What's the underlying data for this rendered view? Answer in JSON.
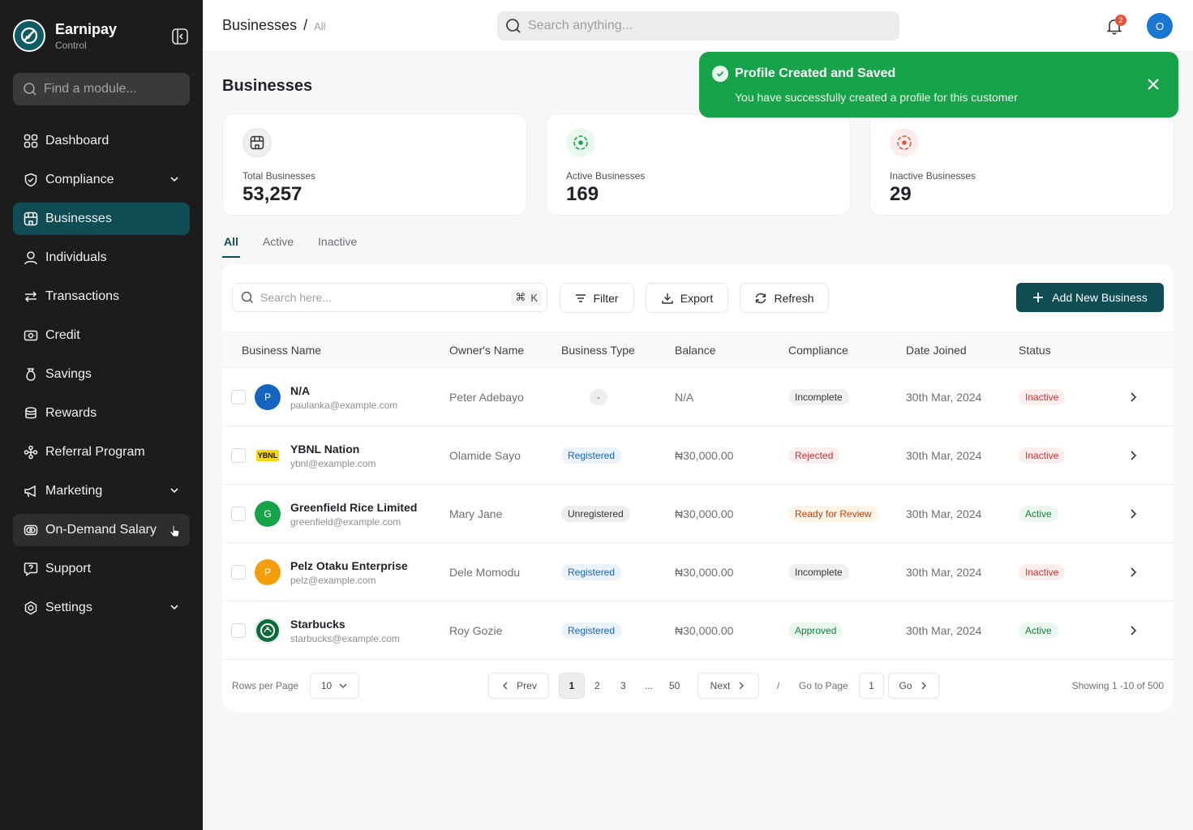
{
  "brand": {
    "name": "Earnipay",
    "sub": "Control"
  },
  "sidebar": {
    "search_placeholder": "Find a module...",
    "items": [
      {
        "label": "Dashboard"
      },
      {
        "label": "Compliance"
      },
      {
        "label": "Businesses"
      },
      {
        "label": "Individuals"
      },
      {
        "label": "Transactions"
      },
      {
        "label": "Credit"
      },
      {
        "label": "Savings"
      },
      {
        "label": "Rewards"
      },
      {
        "label": "Referral Program"
      },
      {
        "label": "Marketing"
      },
      {
        "label": "On-Demand Salary"
      },
      {
        "label": "Support"
      },
      {
        "label": "Settings"
      }
    ]
  },
  "topbar": {
    "breadcrumb_root": "Businesses",
    "breadcrumb_sep": "/",
    "breadcrumb_current": "All",
    "search_placeholder": "Search anything...",
    "notif_count": "2",
    "avatar_initial": "O"
  },
  "page": {
    "title": "Businesses"
  },
  "stats": [
    {
      "label": "Total Businesses",
      "value": "53,257"
    },
    {
      "label": "Active Businesses",
      "value": "169"
    },
    {
      "label": "Inactive Businesses",
      "value": "29"
    }
  ],
  "tabs": [
    {
      "label": "All"
    },
    {
      "label": "Active"
    },
    {
      "label": "Inactive"
    }
  ],
  "toolbar": {
    "search_placeholder": "Search here...",
    "kbd_key": "K",
    "filter": "Filter",
    "export": "Export",
    "refresh": "Refresh",
    "add": "Add New Business"
  },
  "table": {
    "headers": [
      "Business Name",
      "Owner's Name",
      "Business Type",
      "Balance",
      "Compliance",
      "Date Joined",
      "Status"
    ],
    "rows": [
      {
        "initial": "P",
        "name": "N/A",
        "email": "paulanka@example.com",
        "owner": "Peter Adebayo",
        "type": "-",
        "balance": "N/A",
        "compliance": "Incomplete",
        "date": "30th Mar, 2024",
        "status": "Inactive"
      },
      {
        "initial": "YBNL",
        "name": "YBNL Nation",
        "email": "ybnl@example.com",
        "owner": "Olamide Sayo",
        "type": "Registered",
        "balance": "₦30,000.00",
        "compliance": "Rejected",
        "date": "30th Mar, 2024",
        "status": "Inactive"
      },
      {
        "initial": "G",
        "name": "Greenfield Rice Limited",
        "email": "greenfield@example.com",
        "owner": "Mary Jane",
        "type": "Unregistered",
        "balance": "₦30,000.00",
        "compliance": "Ready for Review",
        "date": "30th Mar, 2024",
        "status": "Active"
      },
      {
        "initial": "P",
        "name": "Pelz Otaku Enterprise",
        "email": "pelz@example.com",
        "owner": "Dele Momodu",
        "type": "Registered",
        "balance": "₦30,000.00",
        "compliance": "Incomplete",
        "date": "30th Mar, 2024",
        "status": "Inactive"
      },
      {
        "initial": "",
        "name": "Starbucks",
        "email": "starbucks@example.com",
        "owner": "Roy Gozie",
        "type": "Registered",
        "balance": "₦30,000.00",
        "compliance": "Approved",
        "date": "30th Mar, 2024",
        "status": "Active"
      }
    ]
  },
  "pagination": {
    "rows_label": "Rows per Page",
    "rows_value": "10",
    "prev": "Prev",
    "pages": [
      "1",
      "2",
      "3",
      "...",
      "50"
    ],
    "next": "Next",
    "slash": "/",
    "goto_label": "Go to Page",
    "goto_value": "1",
    "go": "Go",
    "showing": "Showing 1 -10 of 500"
  },
  "toast": {
    "title": "Profile Created and Saved",
    "message": "You have successfully created a  profile for this customer"
  },
  "colors": {
    "primary": "#0f4c54",
    "success": "#16a34a",
    "sidebar": "#1c1c1c"
  }
}
